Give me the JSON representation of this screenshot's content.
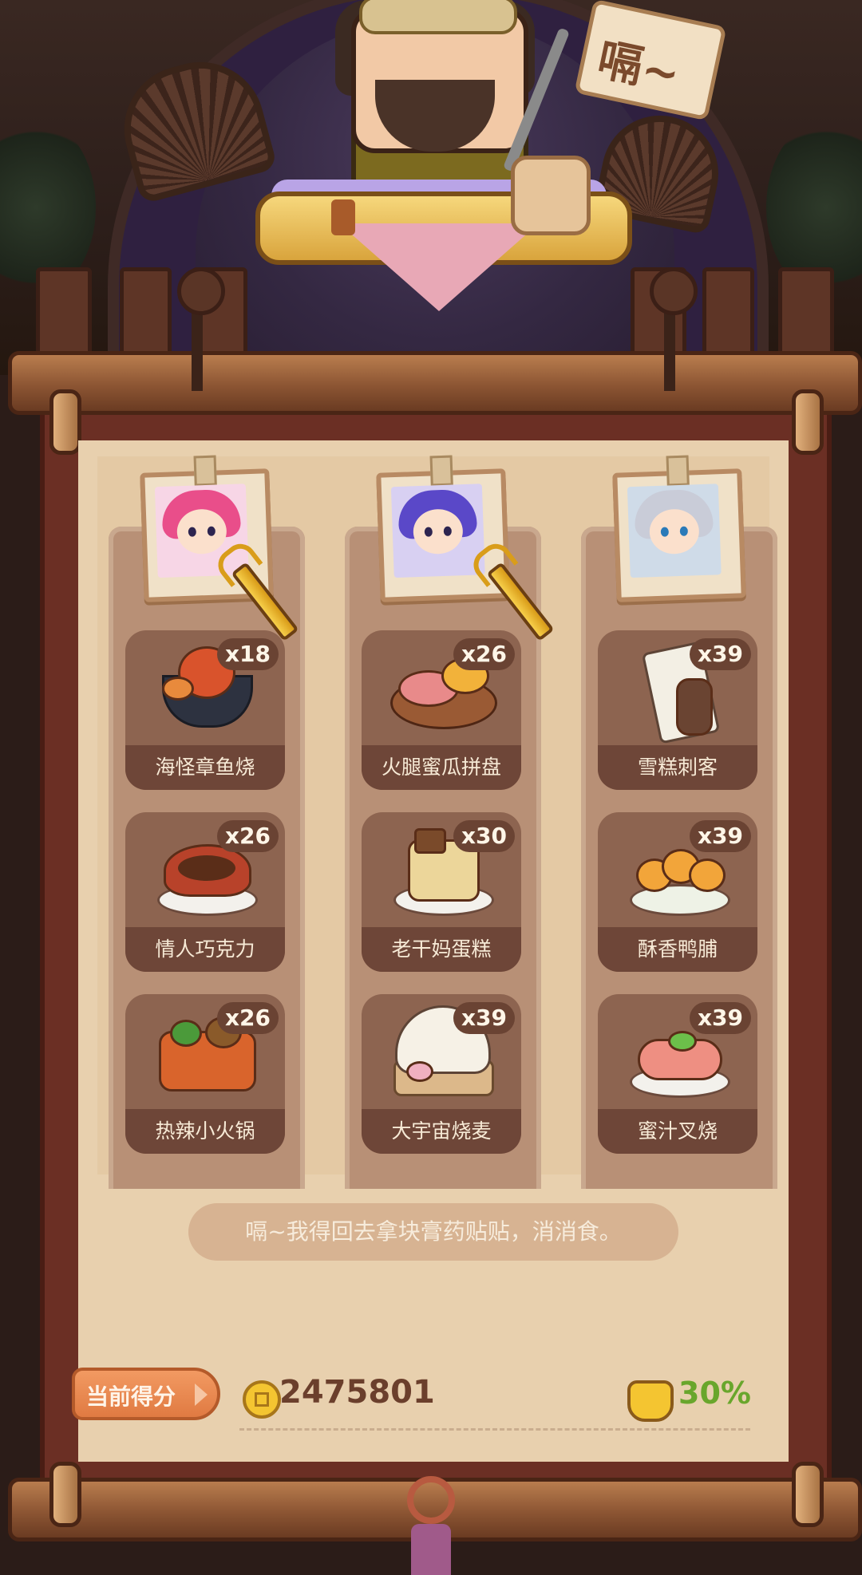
{
  "scene": {
    "sign_text": "嗝~"
  },
  "columns": [
    {
      "character": "pink-hair-girl",
      "hair_color": "#e94e8a",
      "has_fork": true,
      "dishes": [
        {
          "name": "海怪章鱼烧",
          "count": "x18",
          "icon": "octopus-pot-icon"
        },
        {
          "name": "情人巧克力",
          "count": "x26",
          "icon": "chocolate-box-icon"
        },
        {
          "name": "热辣小火锅",
          "count": "x26",
          "icon": "hotpot-icon"
        }
      ]
    },
    {
      "character": "purple-hair-girl",
      "hair_color": "#5a48c8",
      "has_fork": true,
      "dishes": [
        {
          "name": "火腿蜜瓜拼盘",
          "count": "x26",
          "icon": "ham-melon-platter-icon"
        },
        {
          "name": "老干妈蛋糕",
          "count": "x30",
          "icon": "cake-icon"
        },
        {
          "name": "大宇宙烧麦",
          "count": "x39",
          "icon": "shaomai-icon"
        }
      ]
    },
    {
      "character": "silver-hair-boy",
      "hair_color": "#c9ccd8",
      "has_fork": false,
      "dishes": [
        {
          "name": "雪糕刺客",
          "count": "x39",
          "icon": "popsicle-icon"
        },
        {
          "name": "酥香鸭脯",
          "count": "x39",
          "icon": "duck-breast-icon"
        },
        {
          "name": "蜜汁叉烧",
          "count": "x39",
          "icon": "char-siu-icon"
        }
      ]
    }
  ],
  "message": "嗝~我得回去拿块膏药贴贴，消消食。",
  "score": {
    "label": "当前得分",
    "value": "2475801",
    "bonus": "30%"
  },
  "colors": {
    "accent_orange": "#e07a42",
    "bonus_green": "#69a62c",
    "card_bg": "#8d6450"
  }
}
